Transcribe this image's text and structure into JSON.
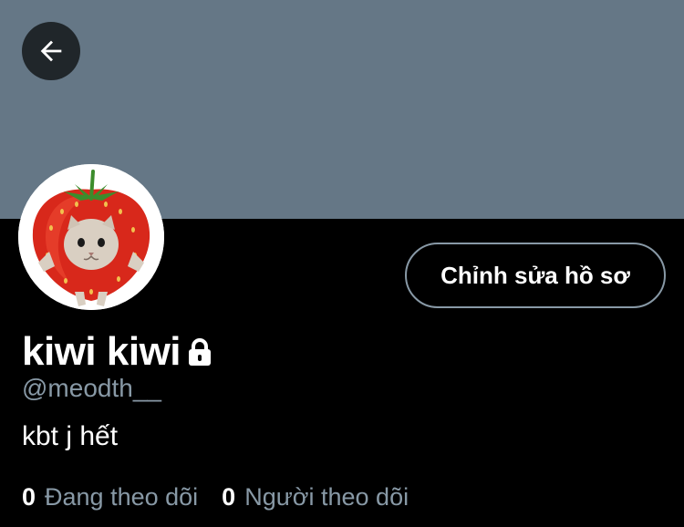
{
  "colors": {
    "banner": "#657786",
    "background": "#000000",
    "secondary_text": "#8899a6",
    "button_border": "#8899a6"
  },
  "header": {
    "back_icon": "arrow-left-icon"
  },
  "profile": {
    "avatar_icon": "strawberry-cat-avatar",
    "edit_button_label": "Chỉnh sửa hồ sơ",
    "display_name": "kiwi kiwi",
    "protected_icon": "lock-icon",
    "handle": "@meodth__",
    "bio": "kbt j hết"
  },
  "stats": {
    "following_count": "0",
    "following_label": "Đang theo dõi",
    "followers_count": "0",
    "followers_label": "Người theo dõi"
  }
}
